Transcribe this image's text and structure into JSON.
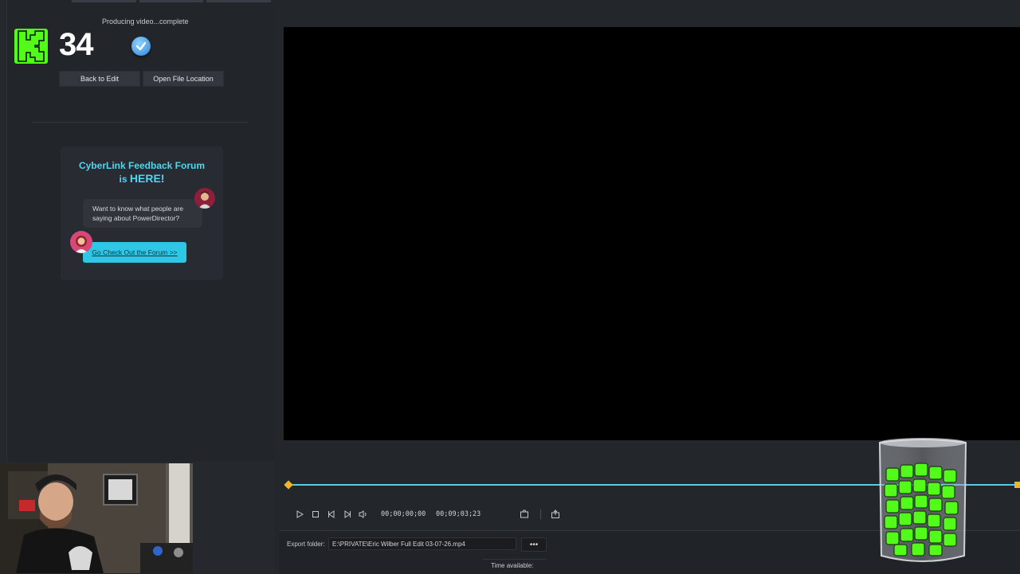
{
  "status": {
    "text": "Producing video...complete"
  },
  "kick": {
    "count": "34"
  },
  "actions": {
    "back_label": "Back to Edit",
    "open_label": "Open File Location"
  },
  "ad": {
    "title_line1": "CyberLink Feedback Forum",
    "title_line2_prefix": "is ",
    "title_line2_emph": "HERE!",
    "bubble_line1": "Want to know what people are",
    "bubble_line2": "saying about PowerDirector?",
    "cta_label": "Go Check Out the Forum >>"
  },
  "player": {
    "current_time": "00;00;00;00",
    "total_time": "00;09;03;23"
  },
  "export": {
    "label": "Export folder:",
    "path": "E:\\PRIVATE\\Eric Wilber Full Edit 03-07-26.mp4",
    "browse_label": "•••",
    "time_available_label": "Time available:"
  },
  "colors": {
    "accent": "#5ac8e8",
    "kick_green": "#53fc18",
    "marker": "#f0b429"
  }
}
